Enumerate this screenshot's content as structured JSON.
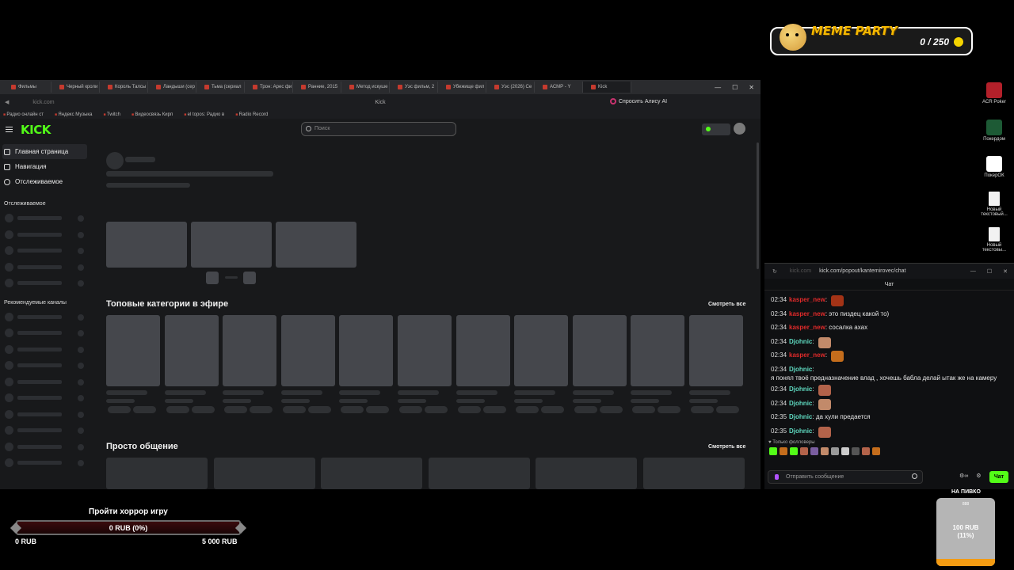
{
  "overlay": {
    "meme_party": {
      "title": "MEME PARTY",
      "count": "0 / 250"
    },
    "goal": {
      "title": "Пройти хоррор игру",
      "value": "0 RUB (0%)",
      "min": "0 RUB",
      "max": "5 000 RUB",
      "progress": 0
    },
    "beer": {
      "title": "НА ПИВКО",
      "top": "888",
      "value": "100 RUB",
      "percent": "(11%)",
      "progress": 0.11
    }
  },
  "browser": {
    "tabs": [
      "Фильмы",
      "Черный кроли",
      "Король Талсы",
      "Ландыши (сер",
      "Тьма (сериал",
      "Трон: Арес фи",
      "Ранние, 2015",
      "Метод искуше",
      "Уэс фильм, 2",
      "Убежище фил",
      "Уэс (2026) Се",
      "АСМР - Y",
      "Kick"
    ],
    "url": "kick.com",
    "page_title": "Kick",
    "alice": "Спросить Алису AI",
    "bookmarks": [
      "Радио онлайн ст",
      "Яндекс Музыка",
      "Twitch",
      "Видеосвязь Кирп",
      "el topos: Радио в",
      "Radio Record"
    ]
  },
  "kick": {
    "logo": "KICK",
    "search_placeholder": "Поиск",
    "nav": [
      {
        "label": "Главная страница"
      },
      {
        "label": "Навигация"
      },
      {
        "label": "Отслеживаемое"
      }
    ],
    "sections": {
      "followed": "Отслеживаемое",
      "recommended": "Рекомендуемые каналы"
    },
    "top_categories": {
      "title": "Топовые категории в эфире",
      "see_all": "Смотреть все"
    },
    "just_chatting": {
      "title": "Просто общение",
      "see_all": "Смотреть все"
    }
  },
  "desktop_icons": [
    {
      "label": "ACR Poker",
      "color": "#b3202a"
    },
    {
      "label": "Покердом",
      "color": "#1d5a35"
    },
    {
      "label": "ПокерОК",
      "color": "#ffffff"
    },
    {
      "label": "Новый текстовый...",
      "color": "#f2f2f2"
    },
    {
      "label": "Новый текстовы...",
      "color": "#f2f2f2"
    }
  ],
  "chat": {
    "domain": "kick.com",
    "path": "kick.com/popout/kantemirovec/chat",
    "title": "Чат",
    "messages": [
      {
        "time": "02:34",
        "user": "kasper_new",
        "color": "#e02a2a",
        "text": "",
        "emote": "#a33316"
      },
      {
        "time": "02:34",
        "user": "kasper_new",
        "color": "#e02a2a",
        "text": "это пиздец какой то)",
        "emote": ""
      },
      {
        "time": "02:34",
        "user": "kasper_new",
        "color": "#e02a2a",
        "text": "сосалка ахах",
        "emote": ""
      },
      {
        "time": "02:34",
        "user": "Djohnic",
        "color": "#5fd9c0",
        "text": "",
        "emote": "#c28a6a"
      },
      {
        "time": "02:34",
        "user": "kasper_new",
        "color": "#e02a2a",
        "text": "",
        "emote": "#c46d1c"
      },
      {
        "time": "02:34",
        "user": "Djohnic",
        "color": "#5fd9c0",
        "text": "я понял твоё предназначение влад , хочешь бабла делай ытак же на камеру",
        "emote": ""
      },
      {
        "time": "02:34",
        "user": "Djohnic",
        "color": "#5fd9c0",
        "text": "",
        "emote": "#b3634a"
      },
      {
        "time": "02:34",
        "user": "Djohnic",
        "color": "#5fd9c0",
        "text": "",
        "emote": "#c28a6a"
      },
      {
        "time": "02:35",
        "user": "Djohnic",
        "color": "#5fd9c0",
        "text": "да хули предается",
        "emote": ""
      },
      {
        "time": "02:35",
        "user": "Djohnic",
        "color": "#5fd9c0",
        "text": "",
        "emote": "#b3634a"
      }
    ],
    "followers_only": "Только фолловеры",
    "input_placeholder": "Отправить сообщение",
    "send_label": "Чат"
  }
}
